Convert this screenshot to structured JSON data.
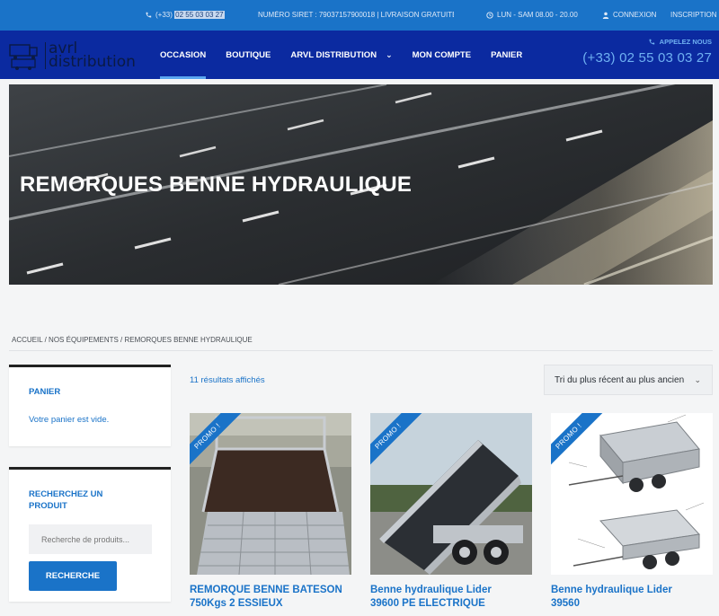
{
  "topbar": {
    "phone_prefix": "(+33)",
    "phone_highlight": "02 55 03 03 27",
    "siret": "NUMÉRO SIRET : 79037157900018 | LIVRAISON GRATUITE !",
    "hours": "LUN - SAM 08.00 - 20.00",
    "login": "CONNEXION",
    "register": "INSCRIPTION"
  },
  "logo": {
    "line1": "avrl",
    "line2": "distribution"
  },
  "nav": {
    "items": [
      "OCCASION",
      "BOUTIQUE",
      "ARVL DISTRIBUTION",
      "MON COMPTE",
      "PANIER"
    ],
    "call_label": "APPELEZ NOUS",
    "call_number": "(+33) 02 55 03 03 27"
  },
  "hero": {
    "title": "REMORQUES BENNE HYDRAULIQUE"
  },
  "breadcrumb": "ACCUEIL / NOS ÉQUIPEMENTS / REMORQUES BENNE HYDRAULIQUE",
  "sidebar": {
    "cart_title": "PANIER",
    "cart_empty": "Votre panier est vide.",
    "search_title": "RECHERCHEZ UN PRODUIT",
    "search_placeholder": "Recherche de produits...",
    "search_button": "RECHERCHE"
  },
  "results": {
    "count": "11 résultats affichés",
    "sort": "Tri du plus récent au plus ancien"
  },
  "products": [
    {
      "badge": "PROMO !",
      "title_line1": "REMORQUE BENNE BATESON",
      "title_line2": "750Kgs 2 ESSIEUX"
    },
    {
      "badge": "PROMO !",
      "title_line1": "Benne hydraulique Lider",
      "title_line2": "39600 PE ELECTRIQUE"
    },
    {
      "badge": "PROMO !",
      "title_line1": "Benne hydraulique Lider",
      "title_line2": "39560"
    }
  ],
  "colors": {
    "primary": "#1a73c8",
    "nav": "#0b2aa0"
  }
}
